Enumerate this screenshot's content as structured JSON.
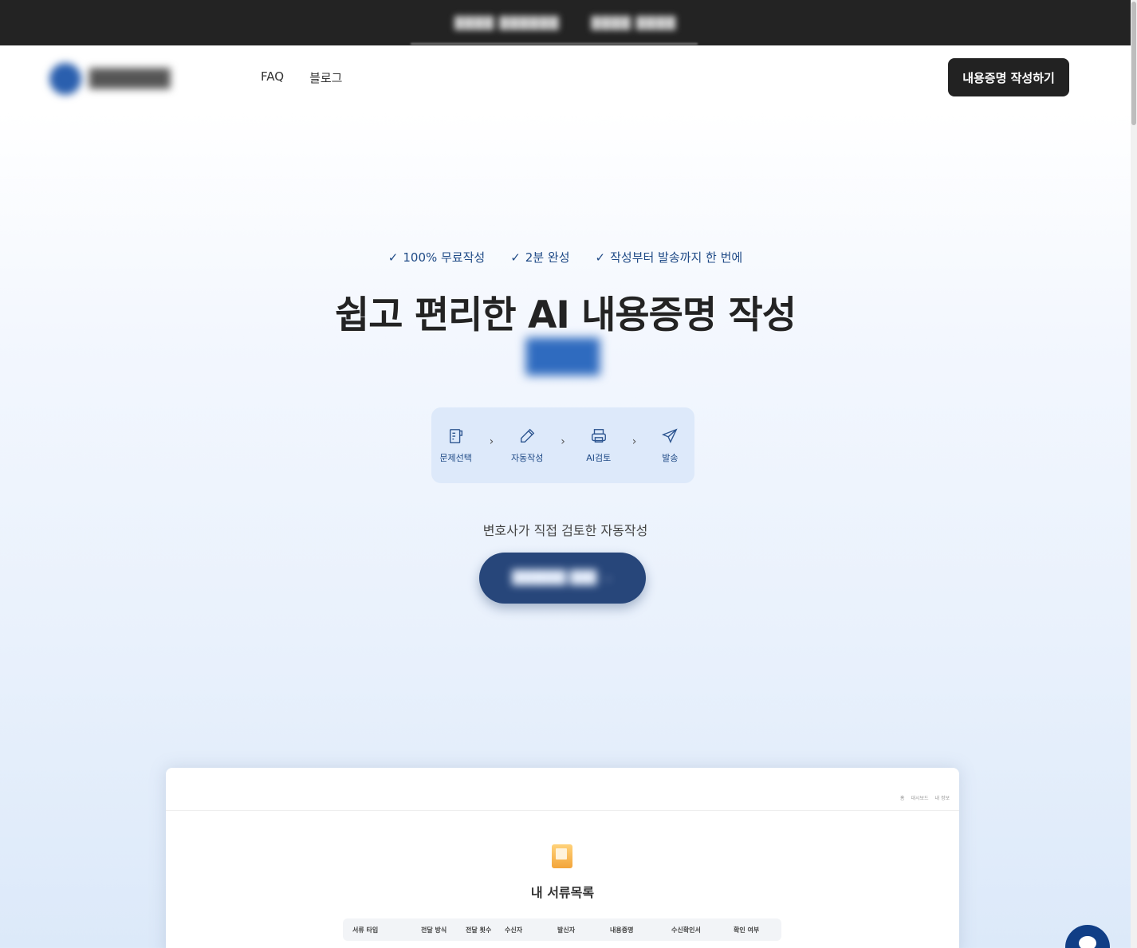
{
  "top_bar": {
    "text_left": "████ ██████",
    "text_right": "████ ████"
  },
  "header": {
    "nav": [
      {
        "label": "FAQ"
      },
      {
        "label": "블로그"
      }
    ],
    "cta_label": "내용증명 작성하기"
  },
  "hero": {
    "checks": [
      "100% 무료작성",
      "2분 완성",
      "작성부터 발송까지 한 번에"
    ],
    "title": "쉽고 편리한 AI 내용증명 작성",
    "steps": [
      "문제선택",
      "자동작성",
      "AI검토",
      "발송"
    ],
    "lawyer_text": "변호사가 직접 검토한 자동작성"
  },
  "preview": {
    "nav": [
      "홈",
      "대시보드",
      "내 정보"
    ],
    "title": "내 서류목록",
    "columns": [
      "서류 타입",
      "전달 방식",
      "전달 횟수",
      "수신자",
      "발신자",
      "내용증명",
      "수신확인서",
      "확인 여부"
    ]
  },
  "colors": {
    "primary_dark": "#232323",
    "accent_blue": "#1f4a86",
    "cta_blue": "#27467a",
    "chat_blue": "#103e86"
  }
}
